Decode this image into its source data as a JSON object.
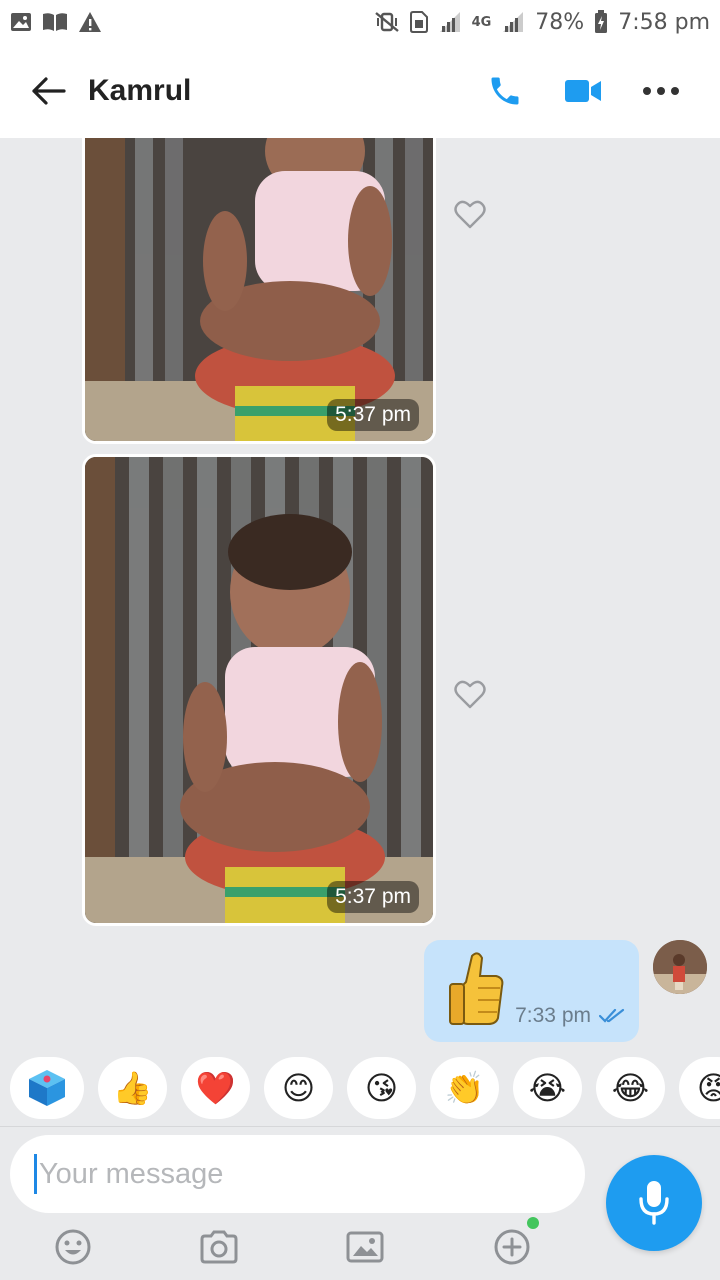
{
  "status_bar": {
    "battery": "78%",
    "time": "7:58 pm",
    "network": "4G"
  },
  "header": {
    "contact_name": "Kamrul"
  },
  "messages": [
    {
      "type": "photo",
      "time": "5:37 pm"
    },
    {
      "type": "photo",
      "time": "5:37 pm"
    },
    {
      "type": "emoji",
      "emoji": "👍",
      "time": "7:33 pm",
      "status": "read"
    }
  ],
  "quick_emojis": [
    "👍",
    "❤️",
    "😊",
    "😘",
    "👏",
    "😭",
    "😂",
    "😡"
  ],
  "composer": {
    "placeholder": "Your message"
  },
  "colors": {
    "accent": "#1e9cf0",
    "outgoing_bubble": "#c6e3fb",
    "background": "#e9eaec"
  }
}
